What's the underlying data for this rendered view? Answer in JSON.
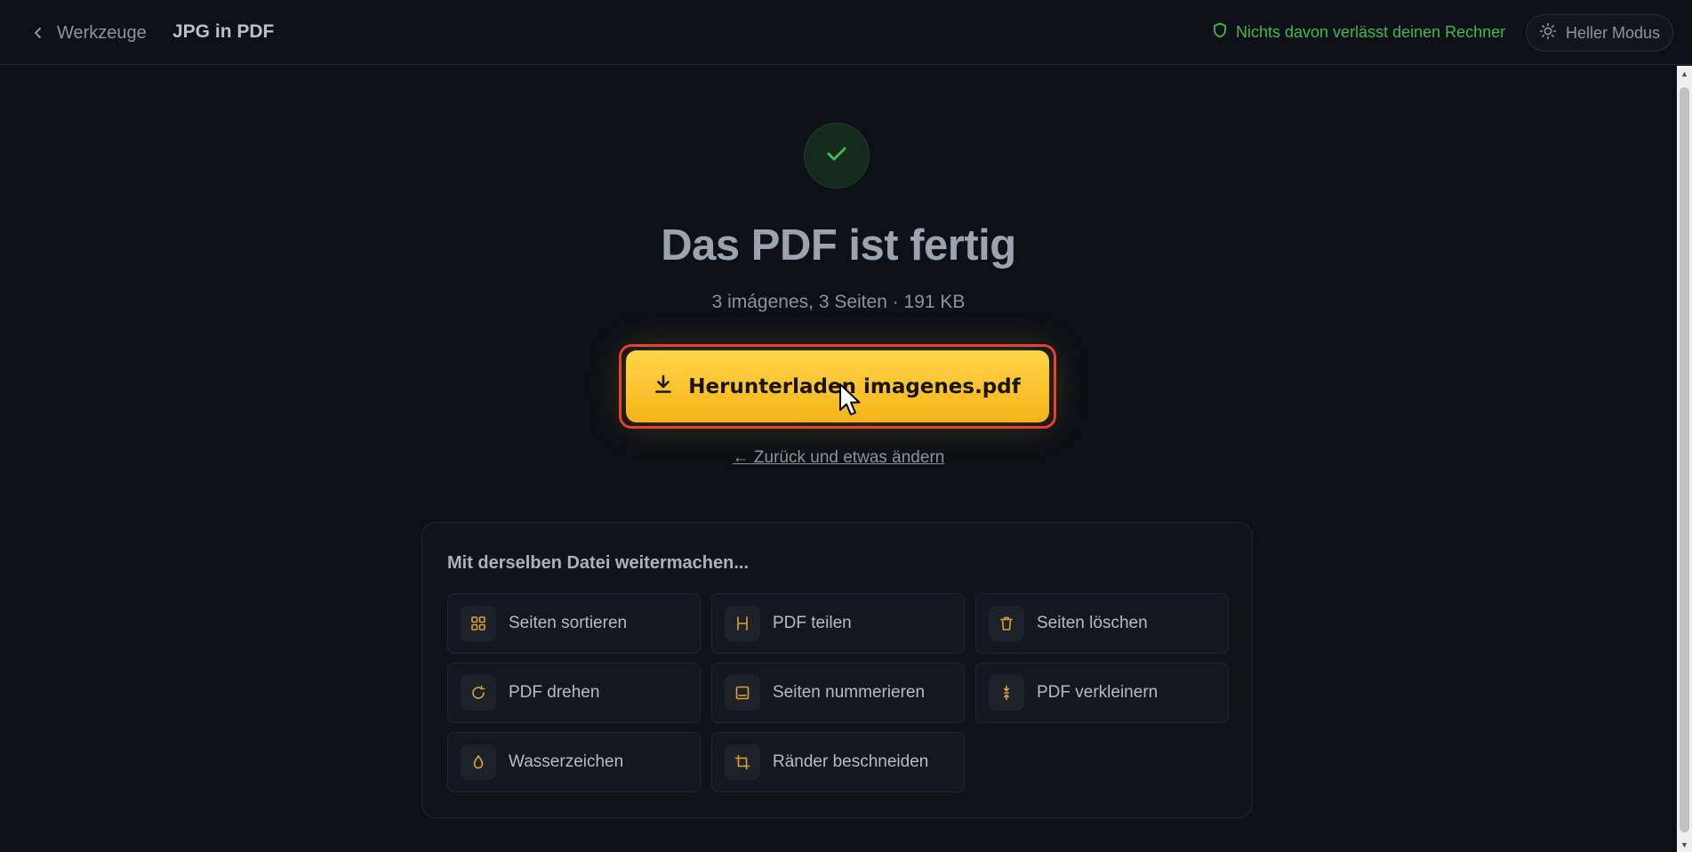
{
  "header": {
    "back_label": "Werkzeuge",
    "title": "JPG in PDF",
    "privacy_note": "Nichts davon verlässt deinen Rechner",
    "theme_toggle_label": "Heller Modus"
  },
  "result": {
    "headline": "Das PDF ist fertig",
    "summary": "3 imágenes, 3 Seiten · 191 KB",
    "download_label": "Herunterladen imagenes.pdf",
    "back_link": "← Zurück und etwas ändern"
  },
  "continue_panel": {
    "title": "Mit derselben Datei weitermachen...",
    "tools": [
      {
        "label": "Seiten sortieren",
        "icon": "grid-icon"
      },
      {
        "label": "PDF teilen",
        "icon": "split-icon"
      },
      {
        "label": "Seiten löschen",
        "icon": "trash-icon"
      },
      {
        "label": "PDF drehen",
        "icon": "rotate-icon"
      },
      {
        "label": "Seiten nummerieren",
        "icon": "page-number-icon"
      },
      {
        "label": "PDF verkleinern",
        "icon": "compress-icon"
      },
      {
        "label": "Wasserzeichen",
        "icon": "droplet-icon"
      },
      {
        "label": "Ränder beschneiden",
        "icon": "crop-icon"
      }
    ]
  },
  "colors": {
    "background": "#0d1117",
    "accent": "#f6b418",
    "success": "#3fb950",
    "highlight_outline": "#e53935"
  }
}
